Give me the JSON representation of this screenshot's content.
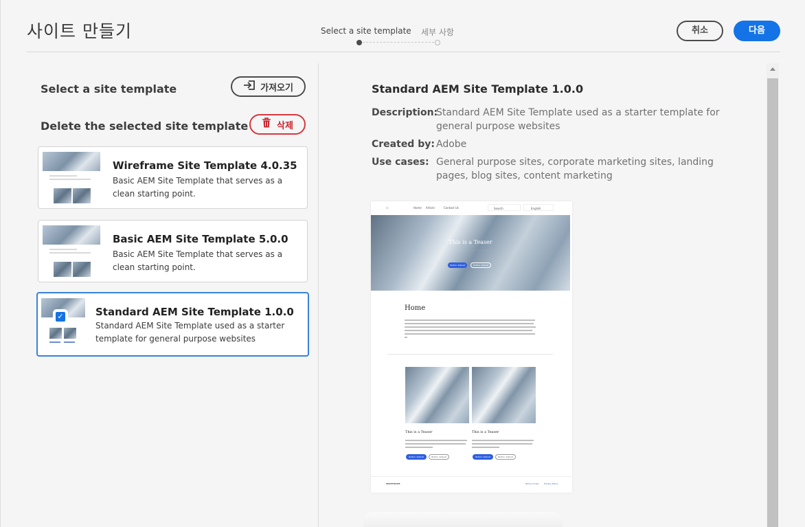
{
  "header": {
    "title": "사이트 만들기",
    "steps": [
      "Select a site template",
      "세부 사항"
    ],
    "cancel_label": "취소",
    "next_label": "다음"
  },
  "sidebar": {
    "select_title": "Select a site template",
    "import_label": "가져오기",
    "delete_title": "Delete the selected site template",
    "delete_label": "삭제",
    "templates": [
      {
        "title": "Wireframe Site Template 4.0.35",
        "desc": "Basic AEM Site Template that serves as a clean starting point."
      },
      {
        "title": "Basic AEM Site Template 5.0.0",
        "desc": "Basic AEM Site Template that serves as a clean starting point."
      },
      {
        "title": "Standard AEM Site Template 1.0.0",
        "desc": "Standard AEM Site Template used as a starter template for general purpose websites"
      }
    ]
  },
  "detail": {
    "title": "Standard AEM Site Template 1.0.0",
    "description_key": "Description:",
    "description": "Standard AEM Site Template used as a starter template for general purpose websites",
    "created_key": "Created by:",
    "created": "Adobe",
    "usecases_key": "Use cases:",
    "usecases": "General purpose sites, corporate marketing sites, landing pages, blog sites, content marketing"
  },
  "preview": {
    "nav_items": [
      "Home",
      "Article",
      "Contact Us"
    ],
    "search": "Search",
    "language": "English",
    "hero_title": "This is a Teaser",
    "button_default": "Button default",
    "page_heading": "Home",
    "teaser_title": "This is a Teaser",
    "footer_brand": "WIREFRAME",
    "footer_links": [
      "Terms of Use",
      "Privacy Policy"
    ]
  },
  "colors": {
    "accent": "#1473e6",
    "danger": "#d7373f",
    "selected_border": "#3682db"
  }
}
